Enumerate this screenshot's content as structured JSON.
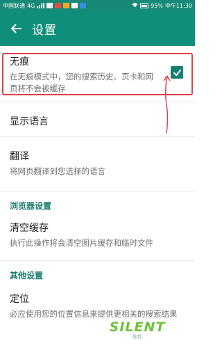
{
  "status_bar": {
    "carrier": "中国联通",
    "network": "4G",
    "battery": "95%",
    "time": "中午11:30"
  },
  "app_bar": {
    "title": "设置",
    "back_icon": "arrow-left-icon"
  },
  "settings": {
    "incognito": {
      "title": "无痕",
      "description": "在无痕模式中，您的搜索历史、页卡和网页将不会被缓存",
      "checked": true
    },
    "display_language": {
      "title": "显示语言"
    },
    "translate": {
      "title": "翻译",
      "description": "将网页翻译到您选择的语言"
    },
    "browser_section": {
      "header": "浏览器设置"
    },
    "clear_cache": {
      "title": "清空缓存",
      "description": "执行此操作将会清空图片缓存和临时文件"
    },
    "other_section": {
      "header": "其他设置"
    },
    "location": {
      "title": "定位",
      "description": "必应使用您的位置信息来提供更相关的搜索结果"
    }
  },
  "watermark": {
    "text": "SILENT",
    "sub": "软件"
  },
  "colors": {
    "toolbar": "#0f8f79",
    "status_bar": "#178a77",
    "accent": "#11806e",
    "section_header": "#1b7d6e",
    "highlight": "#d9434a"
  }
}
